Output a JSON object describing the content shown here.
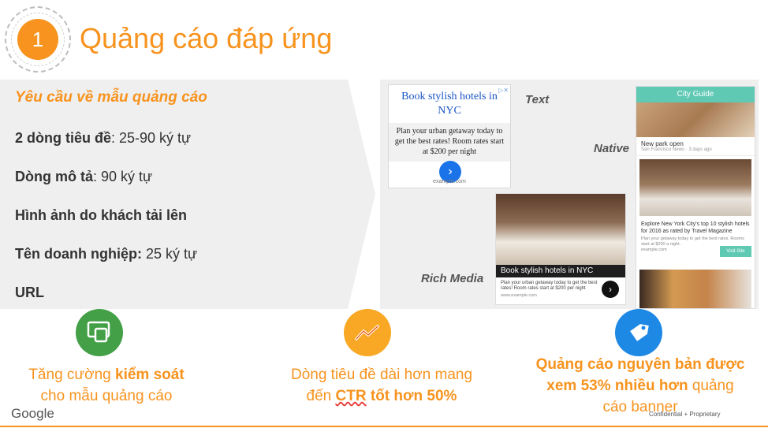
{
  "header": {
    "number": "1",
    "title": "Quảng cáo đáp ứng"
  },
  "requirements": {
    "heading": "Yêu cầu về mẫu quảng cáo",
    "items": [
      {
        "bold": "2 dòng tiêu đề",
        "rest": ": 25-90 ký tự"
      },
      {
        "bold": "Dòng mô tả",
        "rest": ": 90 ký tự"
      },
      {
        "bold": "Hình ảnh do khách tải lên",
        "rest": ""
      },
      {
        "bold": "Tên doanh nghiệp:",
        "rest": " 25 ký tự"
      },
      {
        "bold": "URL",
        "rest": ""
      }
    ]
  },
  "showcase": {
    "labels": {
      "text": "Text",
      "native": "Native",
      "rich": "Rich Media"
    },
    "text_ad": {
      "headline": "Book stylish hotels in NYC",
      "description": "Plan your urban getaway today to get the best rates! Room rates start at $200 per night",
      "source": "example.com"
    },
    "native_ad": {
      "bar_title": "City Guide",
      "item1_title": "New park open",
      "item1_sub": "San Francisco News · 3 days ago",
      "item2_title": "Explore New York City's top 10 stylish hotels for 2016 as rated by Travel Magazine",
      "item2_sub": "Plan your getaway today to get the best rates. Rooms start at $200 a night.",
      "item2_source": "example.com",
      "visit_label": "Visit Site"
    },
    "rich_ad": {
      "caption": "Book stylish hotels in NYC",
      "description": "Plan your urban getaway today to get the best rates! Room rates start at $200 per night",
      "source": "www.example.com"
    }
  },
  "benefits": [
    {
      "pre": "Tăng cường ",
      "bold": "kiểm soát",
      "post": "cho mẫu quảng cáo",
      "icon": "devices-icon",
      "color": "#43a047"
    },
    {
      "pre": "Dòng tiêu đề dài hơn mang",
      "bold_underlined": "CTR",
      "mid": "đến ",
      "bold": " tốt hơn 50%",
      "icon": "trending-up-icon",
      "color": "#f9a825"
    },
    {
      "line1": "Quảng cáo nguyên bản được",
      "bold2": "xem 53% nhiều hơn",
      "rest2": " quảng",
      "line3": "cáo banner",
      "icon": "tag-icon",
      "color": "#1e88e5"
    }
  ],
  "footer": {
    "brand": "Google",
    "confidential": "Confidential + Proprietary"
  },
  "colors": {
    "accent": "#f7931e",
    "panel": "#efefef"
  }
}
